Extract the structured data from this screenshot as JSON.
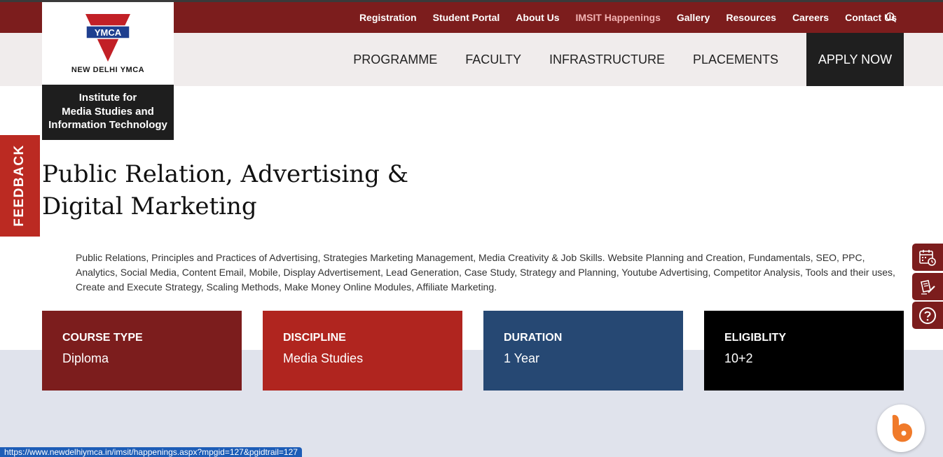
{
  "top_nav": {
    "links": [
      {
        "label": "Registration",
        "highlight": false
      },
      {
        "label": "Student Portal",
        "highlight": false
      },
      {
        "label": "About Us",
        "highlight": false
      },
      {
        "label": "IMSIT Happenings",
        "highlight": true
      },
      {
        "label": "Gallery",
        "highlight": false
      },
      {
        "label": "Resources",
        "highlight": false
      },
      {
        "label": "Careers",
        "highlight": false
      },
      {
        "label": "Contact Us",
        "highlight": false
      }
    ],
    "search_icon": "search-icon"
  },
  "main_nav": {
    "items": [
      "PROGRAMME",
      "FACULTY",
      "INFRASTRUCTURE",
      "PLACEMENTS"
    ],
    "apply_label": "APPLY NOW"
  },
  "logo": {
    "emblem_text": "YMCA",
    "city_prefix": "NEW DELHI",
    "city_suffix": "YMCA",
    "institute_line1": "Institute for",
    "institute_line2": "Media Studies and",
    "institute_line3": "Information Technology"
  },
  "feedback": {
    "label": "FEEDBACK"
  },
  "page": {
    "title": "Public Relation, Advertising & Digital Marketing",
    "description": "Public Relations, Principles and Practices of Advertising, Strategies Marketing Management, Media Creativity & Job Skills. Website Planning and Creation, Fundamentals, SEO, PPC, Analytics, Social Media, Content Email, Mobile, Display Advertisement, Lead Generation, Case Study, Strategy and Planning, Youtube Advertising, Competitor Analysis, Tools and their uses, Create and Execute Strategy, Scaling Methods, Make Money Online Modules, Affiliate Marketing."
  },
  "cards": [
    {
      "label": "COURSE TYPE",
      "value": "Diploma"
    },
    {
      "label": "DISCIPLINE",
      "value": "Media Studies"
    },
    {
      "label": "DURATION",
      "value": "1 Year"
    },
    {
      "label": "ELIGIBLITY",
      "value": "10+2"
    }
  ],
  "side_icons": [
    "calendar-clock-icon",
    "form-pen-icon",
    "question-icon"
  ],
  "chat_icon": "chat-bot-icon",
  "status_bar": {
    "url": "https://www.newdelhiymca.in/imsit/happenings.aspx?mpgid=127&pgidtrail=127"
  },
  "colors": {
    "maroon": "#7c1d1d",
    "red": "#b0251f",
    "navy": "#264873",
    "black": "#000000",
    "nav_bg": "#f0ecec",
    "band_bg": "#e0e3ec",
    "highlight_link": "#f1b2b2"
  }
}
